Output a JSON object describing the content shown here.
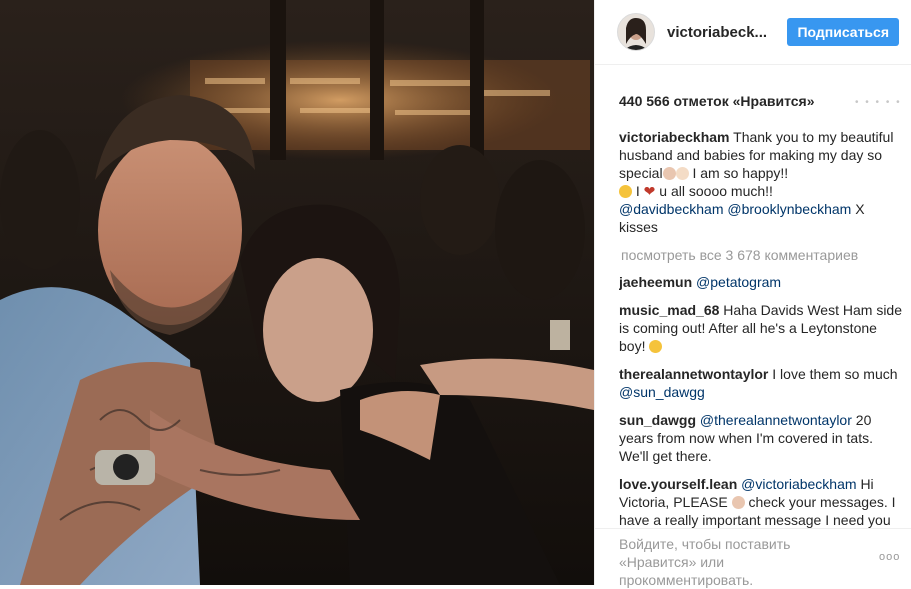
{
  "post": {
    "username": "victoriabeck...",
    "follow_label": "Подписаться",
    "likes": "440 566 отметок «Нравится»",
    "more_dots": "• • • • •"
  },
  "caption": {
    "user": "victoriabeckham",
    "text1": "Thank you to my beautiful husband and babies for making my day so special",
    "text2": " I am so happy!!",
    "text3": " I ",
    "text4": " u all soooo much!!",
    "mention1": "@davidbeckham",
    "mention2": "@brooklynbeckham",
    "text5": " X kisses"
  },
  "view_all": "посмотреть все 3 678 комментариев",
  "comments": [
    {
      "user": "jaeheemun",
      "mention": "@petatogram",
      "text": ""
    },
    {
      "user": "music_mad_68",
      "text": "Haha Davids West Ham side is coming out! After all he's a Leytonstone boy!"
    },
    {
      "user": "therealannetwontaylor",
      "text": "I love them so much",
      "mention": "@sun_dawgg"
    },
    {
      "user": "sun_dawgg",
      "mention": "@therealannetwontaylor",
      "text": "20 years from now when I'm covered in tats. We'll get there."
    },
    {
      "user": "love.yourself.lean",
      "mention": "@victoriabeckham",
      "text_a": "Hi Victoria, PLEASE",
      "text_b": "check your messages. I have a really important message I need you to read. I have no"
    }
  ],
  "footer": {
    "login_prompt": "Войдите, чтобы поставить «Нравится» или прокомментировать.",
    "more_icon": "ooo"
  },
  "colors": {
    "accent": "#3897f0",
    "mention": "#003569",
    "muted": "#999999"
  },
  "icons": [
    "heart-emoji",
    "smile-emoji",
    "tongue-emoji",
    "family-emoji",
    "more-options-icon"
  ]
}
